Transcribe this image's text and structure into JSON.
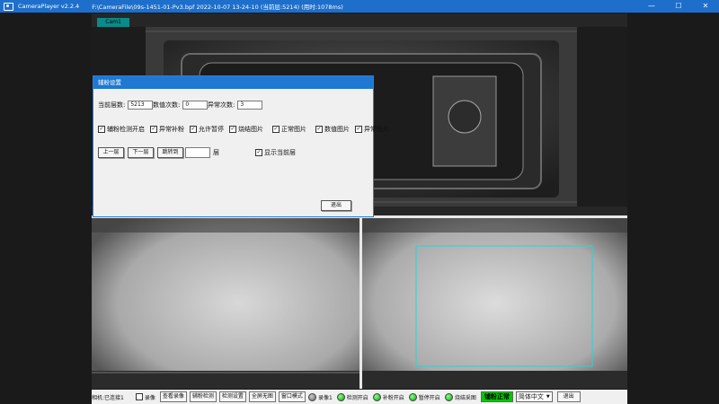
{
  "window": {
    "app_title": "CameraPlayer v2.2.4",
    "file_path": "F:\\CameraFile\\09s-1451-01-Pv3.bpf  2022-10-07 13-24-10  (当前层:5214)  (用时:1078ms)",
    "controls": [
      "—",
      "☐",
      "✕"
    ]
  },
  "camera_tab": "Cam1",
  "dialog": {
    "title": "辅粉设置",
    "fields": [
      {
        "label": "当前层数:",
        "value": "5213"
      },
      {
        "label": "数值次数:",
        "value": "0"
      },
      {
        "label": "异常次数:",
        "value": "3"
      }
    ],
    "checkboxes": [
      {
        "label": "辅粉检测开启",
        "checked": true
      },
      {
        "label": "异常补粉",
        "checked": true
      },
      {
        "label": "允许暂停",
        "checked": true
      },
      {
        "label": "烧结图片",
        "checked": true
      },
      {
        "label": "正常图片",
        "checked": true
      },
      {
        "label": "数值图片",
        "checked": true
      },
      {
        "label": "异常图片",
        "checked": true
      }
    ],
    "nav": {
      "prev": "上一层",
      "next": "下一层",
      "jump": "跳转到",
      "jump_value": "",
      "layer_unit": "层",
      "show_current": "显示当前层",
      "show_current_checked": true
    },
    "exit": "退出"
  },
  "statusbar": {
    "left_label": "相机:已连接1",
    "record_check": "录像",
    "buttons": [
      "查看录像",
      "辅粉检测",
      "检测设置",
      "全屏无图",
      "窗口模式"
    ],
    "indicators": [
      {
        "label": "录像1",
        "color": "gray"
      },
      {
        "label": "检测开启",
        "color": "green"
      },
      {
        "label": "补粉开启",
        "color": "green"
      },
      {
        "label": "暂停开启",
        "color": "green"
      },
      {
        "label": "烧结采图",
        "color": "green"
      }
    ],
    "status_highlight": "铺粉正常",
    "language": "简体中文",
    "exit": "退出"
  },
  "colors": {
    "titlebar": "#1e6fcb",
    "dialog_title": "#1e78d4",
    "roi_box": "#2bd3d3",
    "status_ok": "#00c800"
  }
}
